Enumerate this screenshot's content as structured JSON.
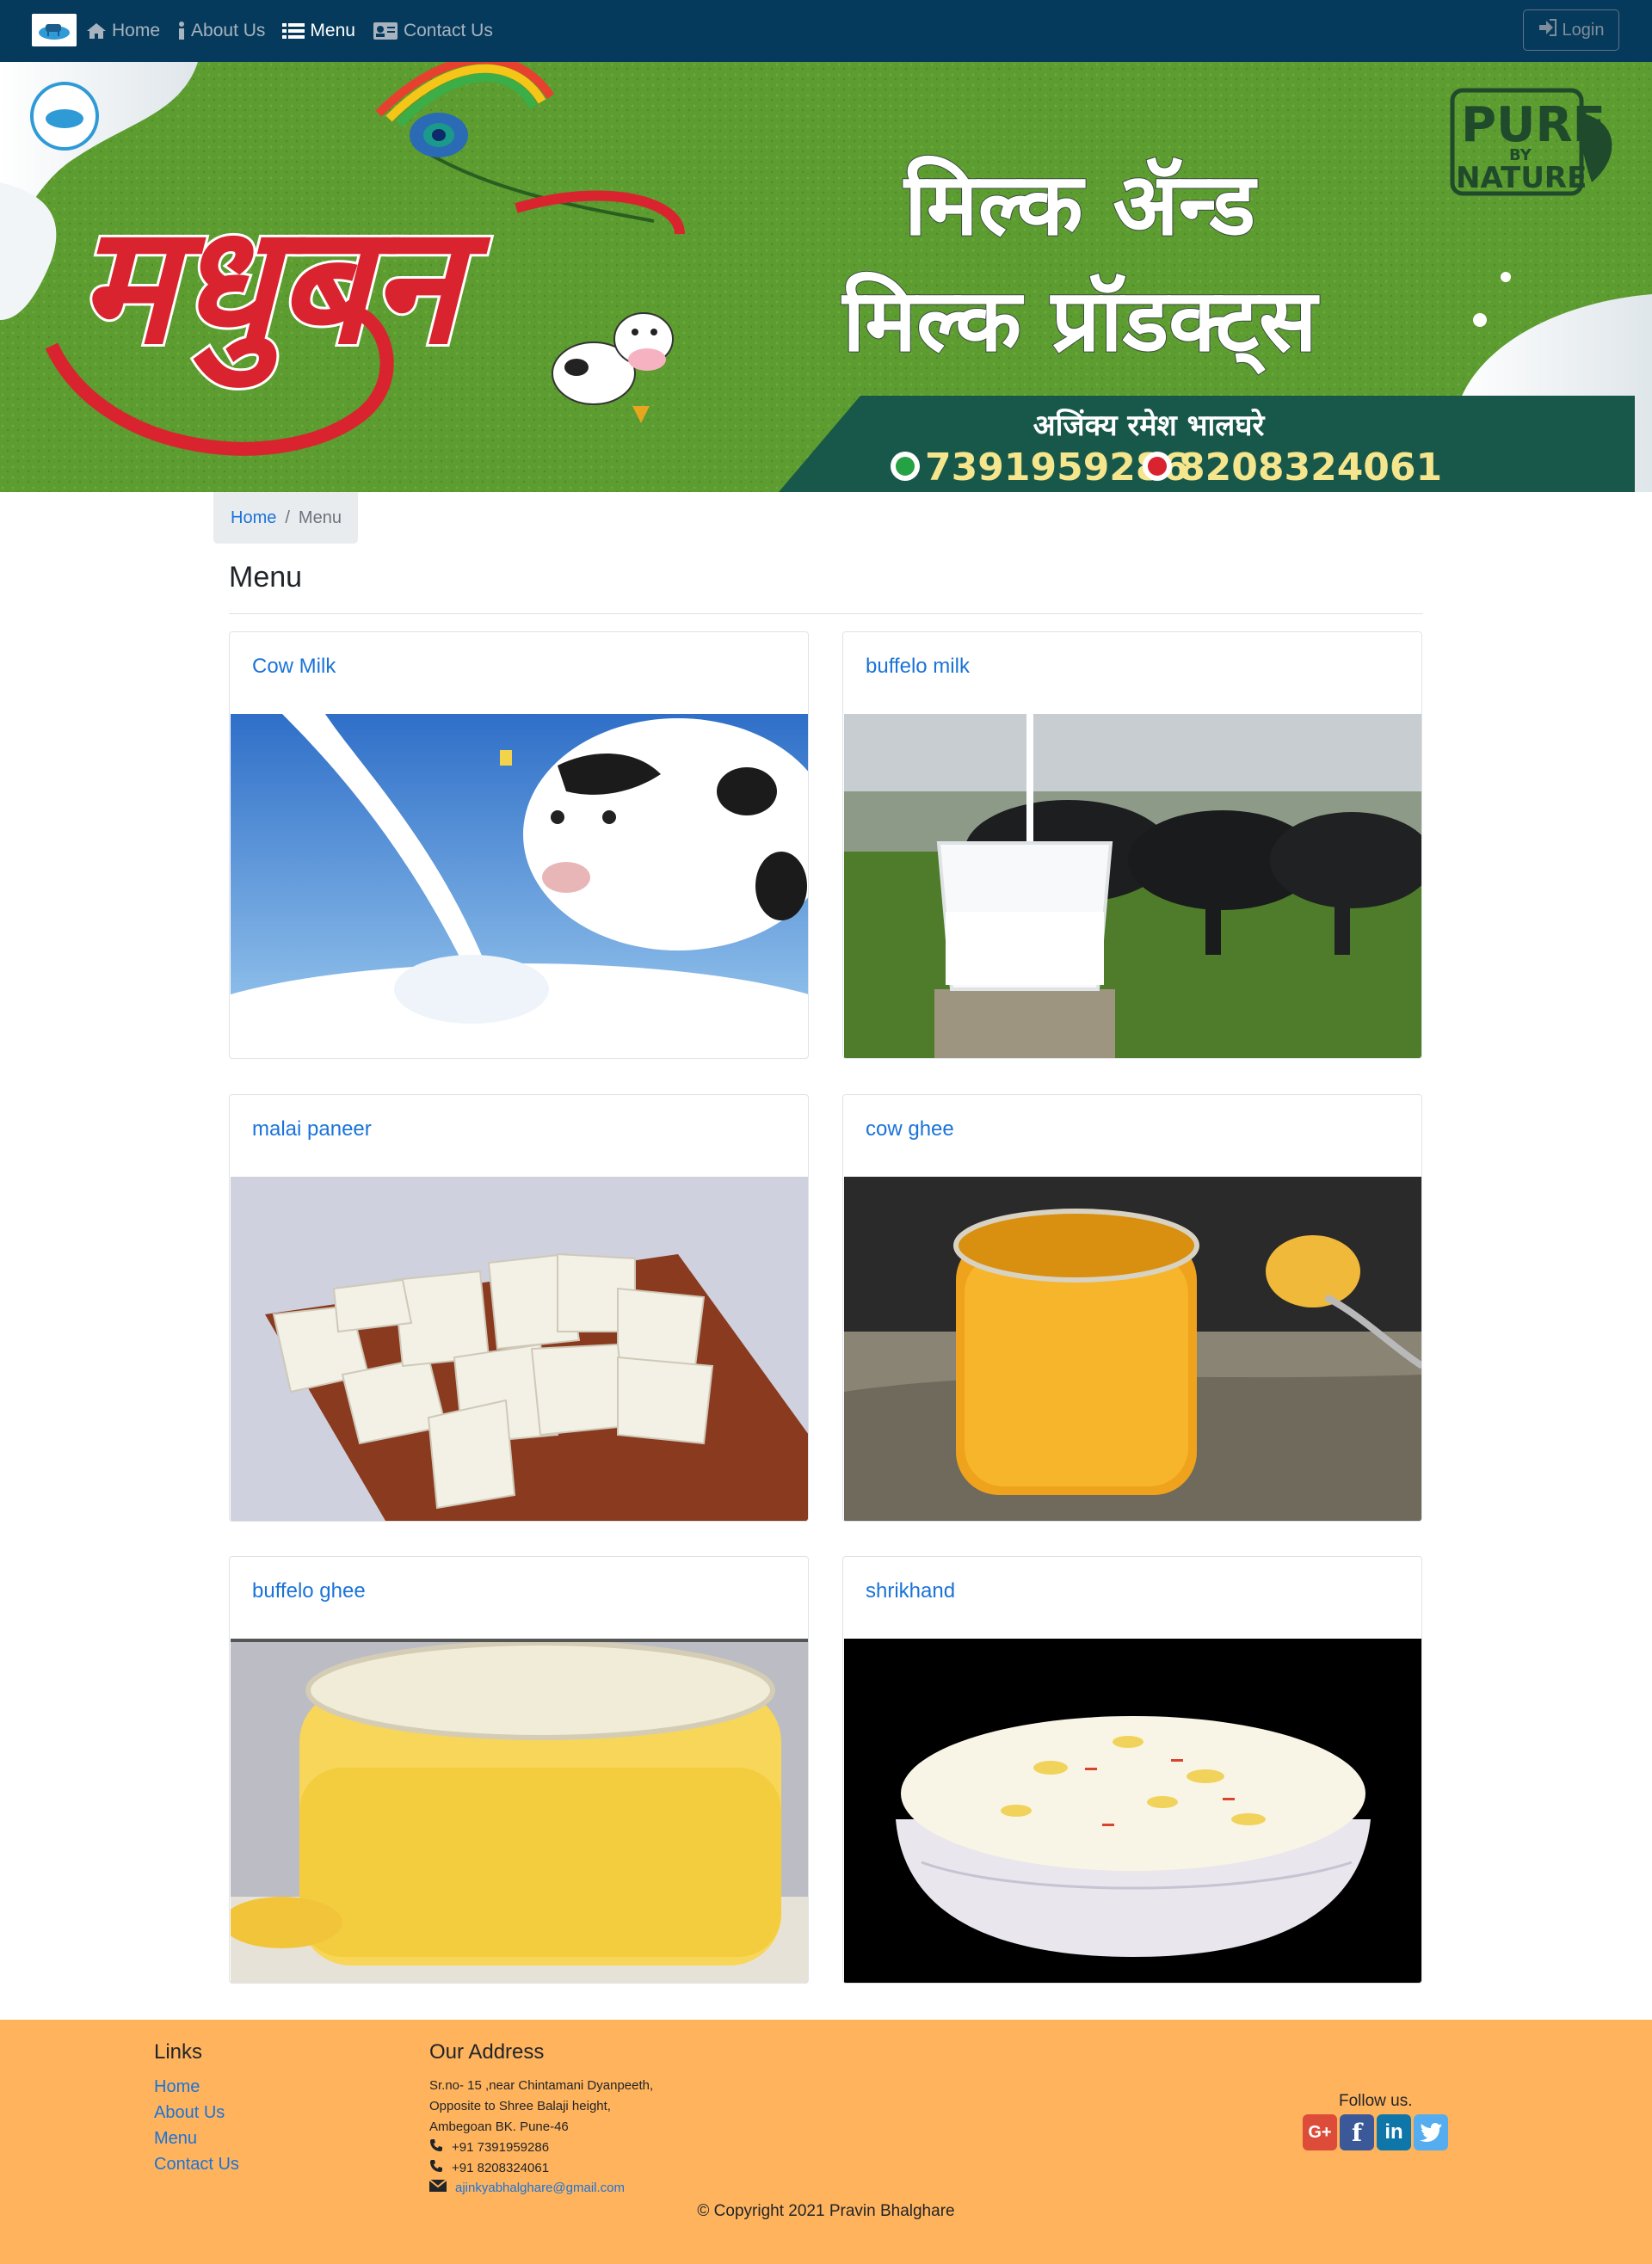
{
  "nav": {
    "items": [
      {
        "label": "Home",
        "icon": "home-icon"
      },
      {
        "label": "About Us",
        "icon": "info-icon"
      },
      {
        "label": "Menu",
        "icon": "list-icon",
        "active": true
      },
      {
        "label": "Contact Us",
        "icon": "contact-card-icon"
      }
    ],
    "login_label": "Login"
  },
  "banner": {
    "brand_script": "मधुबन",
    "headline_line1": "मिल्क ॲन्ड",
    "headline_line2": "मिल्क प्रॉडक्ट्स",
    "owner_name": "अजिंक्य रमेश भालघरे",
    "phone1": "7391959286",
    "phone2": "8208324061",
    "badge_line1": "PURE",
    "badge_line2": "BY",
    "badge_line3": "NATURE"
  },
  "breadcrumb": {
    "home": "Home",
    "separator": "/",
    "current": "Menu"
  },
  "page": {
    "title": "Menu"
  },
  "products": [
    {
      "name": "Cow Milk"
    },
    {
      "name": "buffelo milk"
    },
    {
      "name": "malai paneer"
    },
    {
      "name": "cow ghee"
    },
    {
      "name": "buffelo ghee"
    },
    {
      "name": "shrikhand"
    }
  ],
  "footer": {
    "links_heading": "Links",
    "links": [
      "Home",
      "About Us",
      "Menu",
      "Contact Us"
    ],
    "address_heading": "Our Address",
    "address_lines": [
      "Sr.no- 15 ,near Chintamani Dyanpeeth,",
      "Opposite to Shree Balaji height,",
      "Ambegoan BK. Pune-46"
    ],
    "phone1": "+91 7391959286",
    "phone2": "+91 8208324061",
    "email": "ajinkyabhalghare@gmail.com",
    "follow_label": "Follow us.",
    "social": [
      {
        "name": "google-plus",
        "glyph": "G+",
        "color": "#dd4b39"
      },
      {
        "name": "facebook",
        "glyph": "f",
        "color": "#3b5998"
      },
      {
        "name": "linkedin",
        "glyph": "in",
        "color": "#0e76a8"
      },
      {
        "name": "twitter",
        "glyph": "t",
        "color": "#55acee"
      }
    ],
    "copyright": "© Copyright 2021 Pravin Bhalghare"
  },
  "colors": {
    "navbar": "#063a5c",
    "link": "#1a73d9",
    "footer": "#ffb35c",
    "banner_green": "#5a9a2f",
    "banner_red": "#d9242f"
  }
}
